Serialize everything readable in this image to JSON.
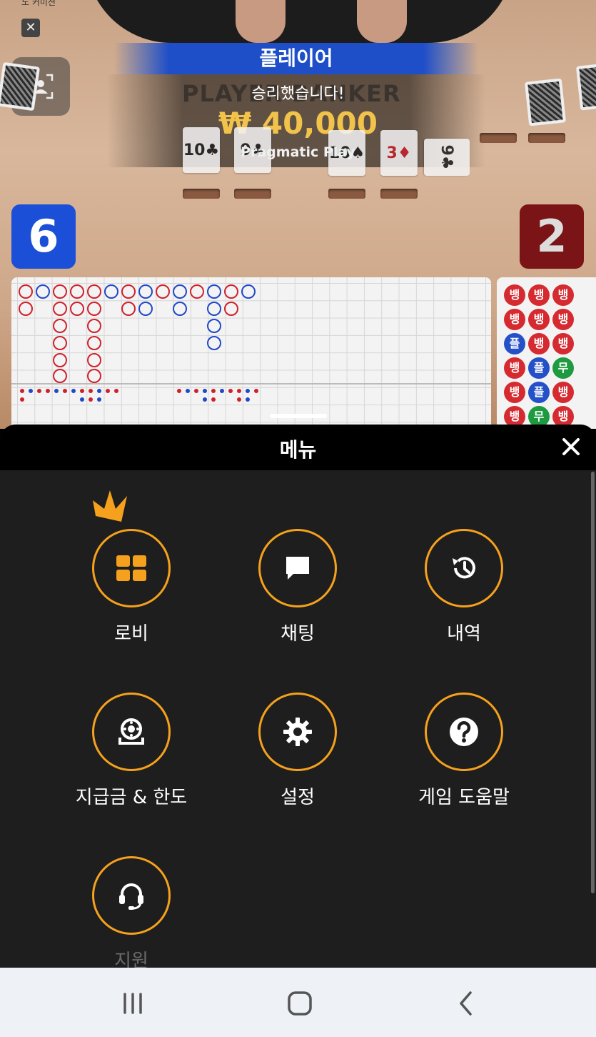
{
  "game": {
    "camera_label": "노 커미션",
    "result_banner": "플레이어",
    "board_labels": "PLAYER BANKER",
    "win_text": "승리했습니다!",
    "win_amount": "₩ 40,000",
    "provider": "Pragmatic Play",
    "player_score": "6",
    "banker_score": "2",
    "player_cards": [
      "10♣",
      "9♣"
    ],
    "banker_cards": [
      "10♠",
      "3♦",
      "9♣"
    ],
    "bead_glyphs": {
      "banker": "뱅",
      "player": "플",
      "tie": "무"
    },
    "colors": {
      "player": "#1c4fd8",
      "banker": "#7a1416",
      "tie": "#1e9a40",
      "gold": "#f1c34a"
    }
  },
  "menu": {
    "title": "메뉴",
    "close_icon": "close-icon",
    "items": [
      {
        "label": "로비",
        "icon": "grid-icon"
      },
      {
        "label": "채팅",
        "icon": "chat-icon"
      },
      {
        "label": "내역",
        "icon": "history-icon"
      },
      {
        "label": "지급금 & 한도",
        "icon": "chip-icon"
      },
      {
        "label": "설정",
        "icon": "gear-icon"
      },
      {
        "label": "게임 도움말",
        "icon": "help-icon"
      },
      {
        "label": "지원",
        "icon": "headset-icon"
      }
    ],
    "accent_color": "#f5a11d"
  },
  "navbar": {
    "buttons": [
      "recent-apps-icon",
      "home-icon",
      "back-icon"
    ]
  }
}
